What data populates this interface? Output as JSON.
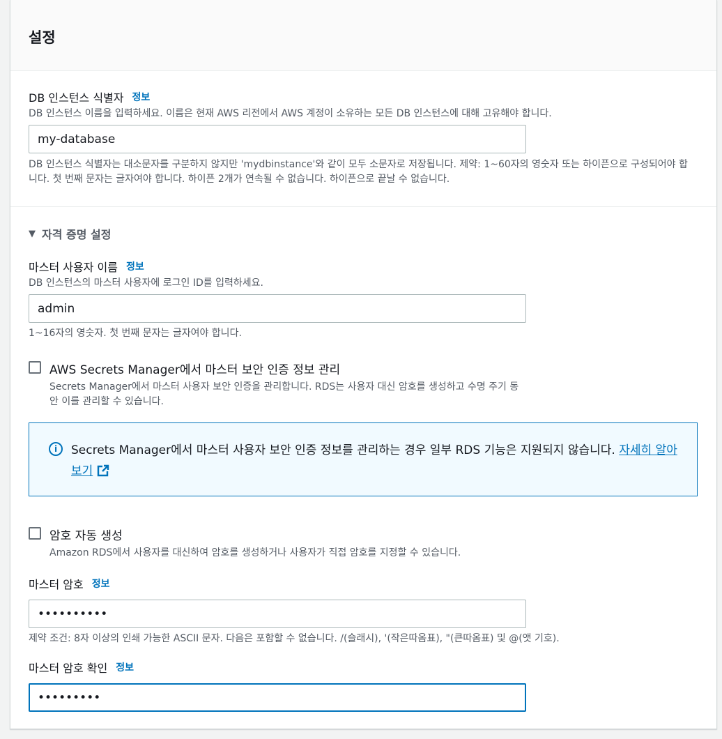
{
  "panel": {
    "title": "설정"
  },
  "db_identifier": {
    "label": "DB 인스턴스 식별자",
    "info": "정보",
    "description": "DB 인스턴스 이름을 입력하세요. 이름은 현재 AWS 리전에서 AWS 계정이 소유하는 모든 DB 인스턴스에 대해 고유해야 합니다.",
    "value": "my-database",
    "constraint": "DB 인스턴스 식별자는 대소문자를 구분하지 않지만 'mydbinstance'와 같이 모두 소문자로 저장됩니다. 제약: 1~60자의 영숫자 또는 하이픈으로 구성되어야 합니다. 첫 번째 문자는 글자여야 합니다. 하이픈 2개가 연속될 수 없습니다. 하이픈으로 끝날 수 없습니다."
  },
  "credentials": {
    "expander_label": "자격 증명 설정",
    "master_username": {
      "label": "마스터 사용자 이름",
      "info": "정보",
      "description": "DB 인스턴스의 마스터 사용자에 로그인 ID를 입력하세요.",
      "value": "admin",
      "constraint": "1~16자의 영숫자. 첫 번째 문자는 글자여야 합니다."
    },
    "secrets_manager": {
      "label": "AWS Secrets Manager에서 마스터 보안 인증 정보 관리",
      "description": "Secrets Manager에서 마스터 사용자 보안 인증을 관리합니다. RDS는 사용자 대신 암호를 생성하고 수명 주기 동안 이를 관리할 수 있습니다.",
      "checked": false
    },
    "alert": {
      "icon": "info-circle-icon",
      "text": "Secrets Manager에서 마스터 사용자 보안 인증 정보를 관리하는 경우 일부 RDS 기능은 지원되지 않습니다.",
      "link": "자세히 알아보기"
    },
    "auto_password": {
      "label": "암호 자동 생성",
      "description": "Amazon RDS에서 사용자를 대신하여 암호를 생성하거나 사용자가 직접 암호를 지정할 수 있습니다.",
      "checked": false
    },
    "master_password": {
      "label": "마스터 암호",
      "info": "정보",
      "value": "••••••••••",
      "constraint": "제약 조건: 8자 이상의 인쇄 가능한 ASCII 문자. 다음은 포함할 수 없습니다. /(슬래시), '(작은따옴표), \"(큰따옴표) 및 @(앳 기호)."
    },
    "confirm_password": {
      "label": "마스터 암호 확인",
      "info": "정보",
      "value": "•••••••••"
    }
  },
  "colors": {
    "accent": "#0073bb",
    "alert_bg": "#f1faff",
    "text_secondary": "#545b64"
  }
}
